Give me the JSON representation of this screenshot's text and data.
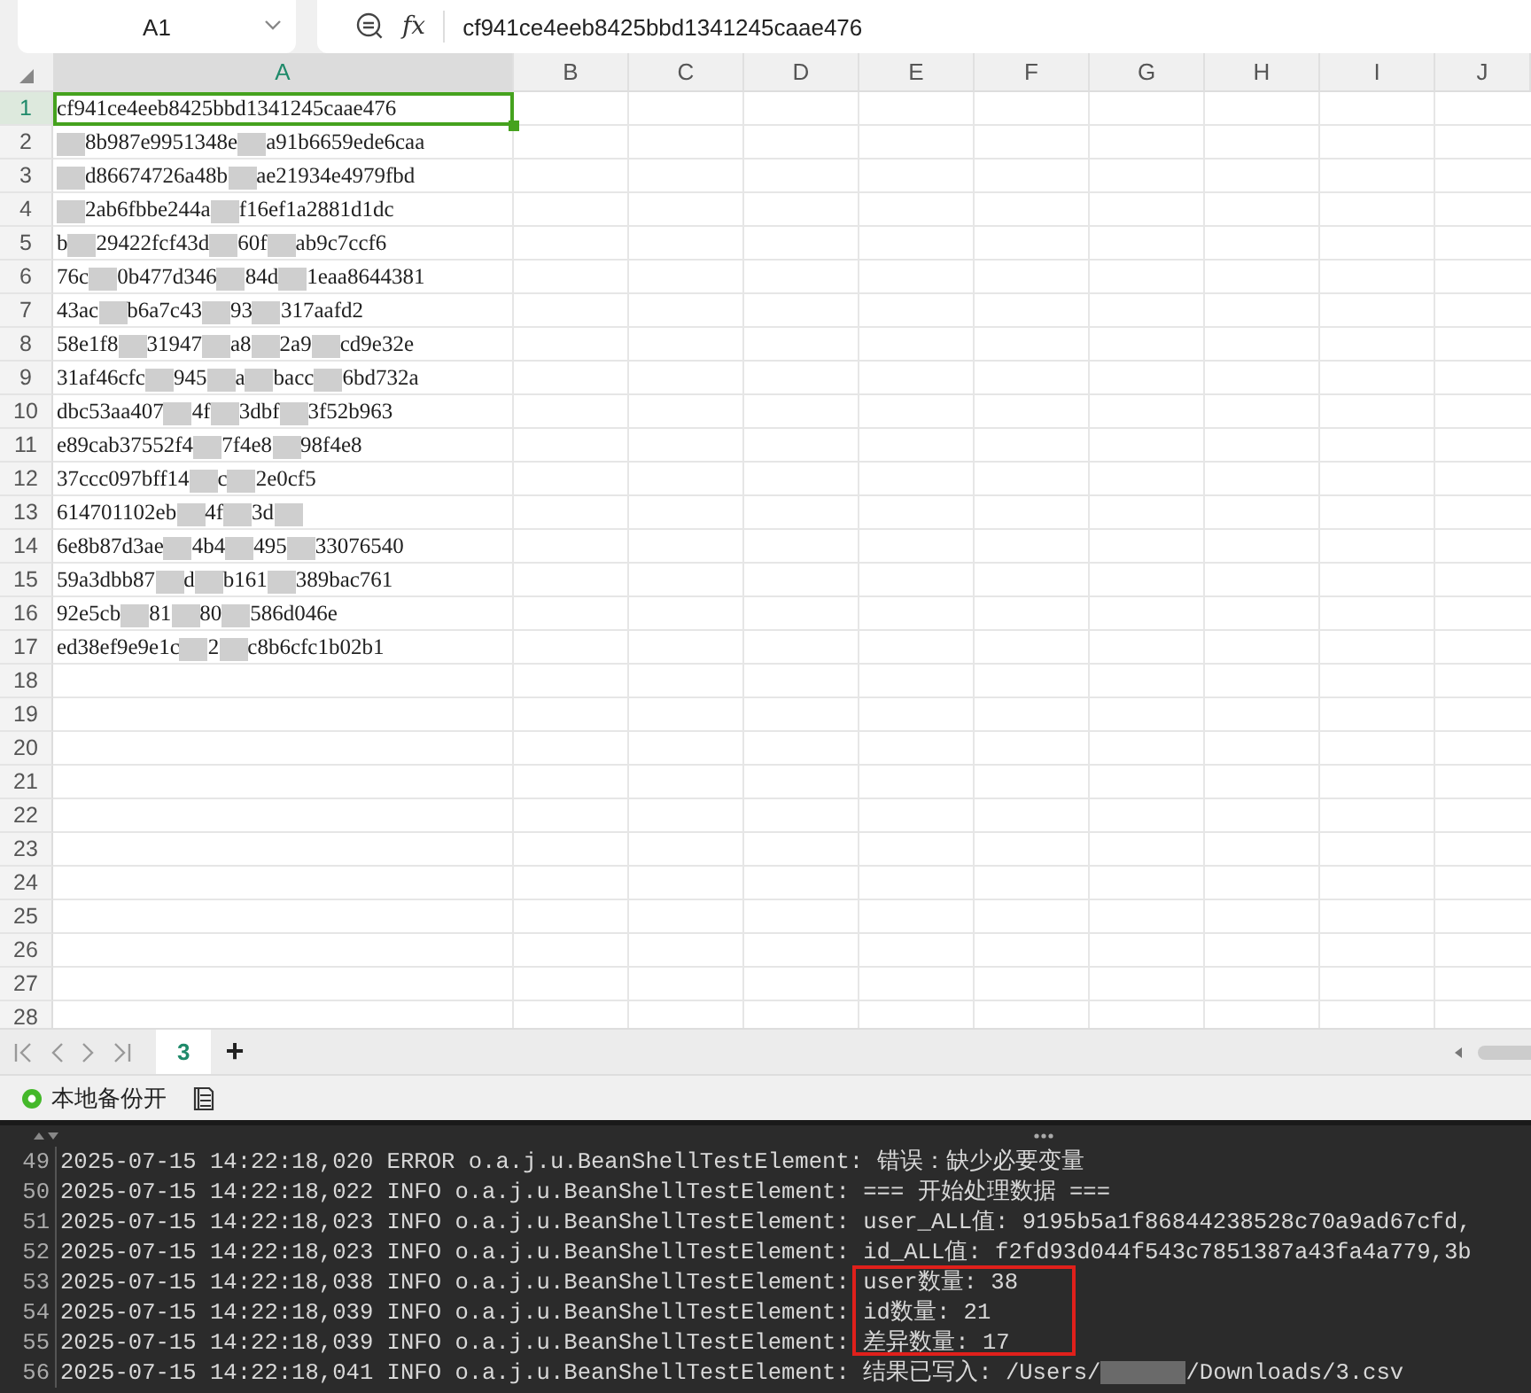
{
  "formula_bar": {
    "cell_ref": "A1",
    "function_label": "fx",
    "value": "cf941ce4eeb8425bbd1341245caae476"
  },
  "columns": [
    {
      "label": "A",
      "selected": true
    },
    {
      "label": "B",
      "selected": false
    },
    {
      "label": "C",
      "selected": false
    },
    {
      "label": "D",
      "selected": false
    },
    {
      "label": "E",
      "selected": false
    },
    {
      "label": "F",
      "selected": false
    },
    {
      "label": "G",
      "selected": false
    },
    {
      "label": "H",
      "selected": false
    },
    {
      "label": "I",
      "selected": false
    },
    {
      "label": "J",
      "selected": false
    }
  ],
  "rows": [
    {
      "num": "1",
      "selected": true,
      "cell_a": [
        "cf941ce4eeb8425bbd1341245caae476"
      ]
    },
    {
      "num": "2",
      "selected": false,
      "leading_redaction": true,
      "cell_a": [
        "8b987e9951348e",
        "a91b6659ede6caa"
      ]
    },
    {
      "num": "3",
      "selected": false,
      "leading_redaction": true,
      "cell_a": [
        "d86674726a48b",
        "ae21934e4979fbd"
      ]
    },
    {
      "num": "4",
      "selected": false,
      "leading_redaction": true,
      "cell_a": [
        "2ab6fbbe244a",
        "f16ef1a2881d1dc"
      ]
    },
    {
      "num": "5",
      "selected": false,
      "cell_a": [
        "b",
        "29422fcf43d",
        "60f",
        "ab9c7ccf6"
      ]
    },
    {
      "num": "6",
      "selected": false,
      "cell_a": [
        "76c",
        "0b477d346",
        "84d",
        "1eaa8644381"
      ]
    },
    {
      "num": "7",
      "selected": false,
      "cell_a": [
        "43ac",
        "b6a7c43",
        "93",
        "317aafd2"
      ]
    },
    {
      "num": "8",
      "selected": false,
      "cell_a": [
        "58e1f8",
        "31947",
        "a8",
        "2a9",
        "cd9e32e"
      ]
    },
    {
      "num": "9",
      "selected": false,
      "cell_a": [
        "31af46cfc",
        "945",
        "a",
        "bacc",
        "6bd732a"
      ]
    },
    {
      "num": "10",
      "selected": false,
      "cell_a": [
        "dbc53aa407",
        "4f",
        "3dbf",
        "3f52b963"
      ]
    },
    {
      "num": "11",
      "selected": false,
      "cell_a": [
        "e89cab37552f4",
        "7f4e8",
        "98f4e8"
      ]
    },
    {
      "num": "12",
      "selected": false,
      "cell_a": [
        "37ccc097bff14",
        "c",
        "2e0cf5"
      ]
    },
    {
      "num": "13",
      "selected": false,
      "trailing_redaction": true,
      "cell_a": [
        "614701102eb",
        "4f",
        "3d"
      ]
    },
    {
      "num": "14",
      "selected": false,
      "cell_a": [
        "6e8b87d3ae",
        "4b4",
        "495",
        "33076540"
      ]
    },
    {
      "num": "15",
      "selected": false,
      "cell_a": [
        "59a3dbb87",
        "d",
        "b161",
        "389bac761"
      ]
    },
    {
      "num": "16",
      "selected": false,
      "cell_a": [
        "92e5cb",
        "81",
        "80",
        "586d046e"
      ]
    },
    {
      "num": "17",
      "selected": false,
      "cell_a": [
        "ed38ef9e9e1c",
        "2",
        "c8b6cfc1b02b1"
      ]
    },
    {
      "num": "18",
      "selected": false
    },
    {
      "num": "19",
      "selected": false
    },
    {
      "num": "20",
      "selected": false
    },
    {
      "num": "21",
      "selected": false
    },
    {
      "num": "22",
      "selected": false
    },
    {
      "num": "23",
      "selected": false
    },
    {
      "num": "24",
      "selected": false
    },
    {
      "num": "25",
      "selected": false
    },
    {
      "num": "26",
      "selected": false
    },
    {
      "num": "27",
      "selected": false
    },
    {
      "num": "28",
      "selected": false
    }
  ],
  "sheet_tabs": [
    {
      "label": "3",
      "selected": true
    }
  ],
  "add_sheet": "+",
  "status_bar": {
    "backup_label": "本地备份开",
    "backup_on": true
  },
  "console": {
    "lines": [
      {
        "num": "49",
        "source": "2025-07-15 14:22:18,020 ERROR o.a.j.u.BeanShellTestElement:",
        "message": [
          "错误：缺少必要变量"
        ],
        "highlighted": false
      },
      {
        "num": "50",
        "source": "2025-07-15 14:22:18,022 INFO o.a.j.u.BeanShellTestElement:",
        "message": [
          "=== 开始处理数据 ==="
        ],
        "highlighted": false
      },
      {
        "num": "51",
        "source": "2025-07-15 14:22:18,023 INFO o.a.j.u.BeanShellTestElement:",
        "message": [
          "user_ALL值: 9195b5a1f86844238528c70a9ad67cfd,"
        ],
        "highlighted": false
      },
      {
        "num": "52",
        "source": "2025-07-15 14:22:18,023 INFO o.a.j.u.BeanShellTestElement:",
        "message": [
          "id_ALL值: f2fd93d044f543c7851387a43fa4a779,3b"
        ],
        "highlighted": false
      },
      {
        "num": "53",
        "source": "2025-07-15 14:22:18,038 INFO o.a.j.u.BeanShellTestElement:",
        "message": [
          "user数量: 38"
        ],
        "highlighted": true
      },
      {
        "num": "54",
        "source": "2025-07-15 14:22:18,039 INFO o.a.j.u.BeanShellTestElement:",
        "message": [
          "id数量: 21"
        ],
        "highlighted": true
      },
      {
        "num": "55",
        "source": "2025-07-15 14:22:18,039 INFO o.a.j.u.BeanShellTestElement:",
        "message": [
          "差异数量: 17"
        ],
        "highlighted": true
      },
      {
        "num": "56",
        "source": "2025-07-15 14:22:18,041 INFO o.a.j.u.BeanShellTestElement:",
        "message": [
          "结果已写入: /Users/",
          "/Downloads/3.csv"
        ],
        "highlighted": false
      }
    ]
  }
}
